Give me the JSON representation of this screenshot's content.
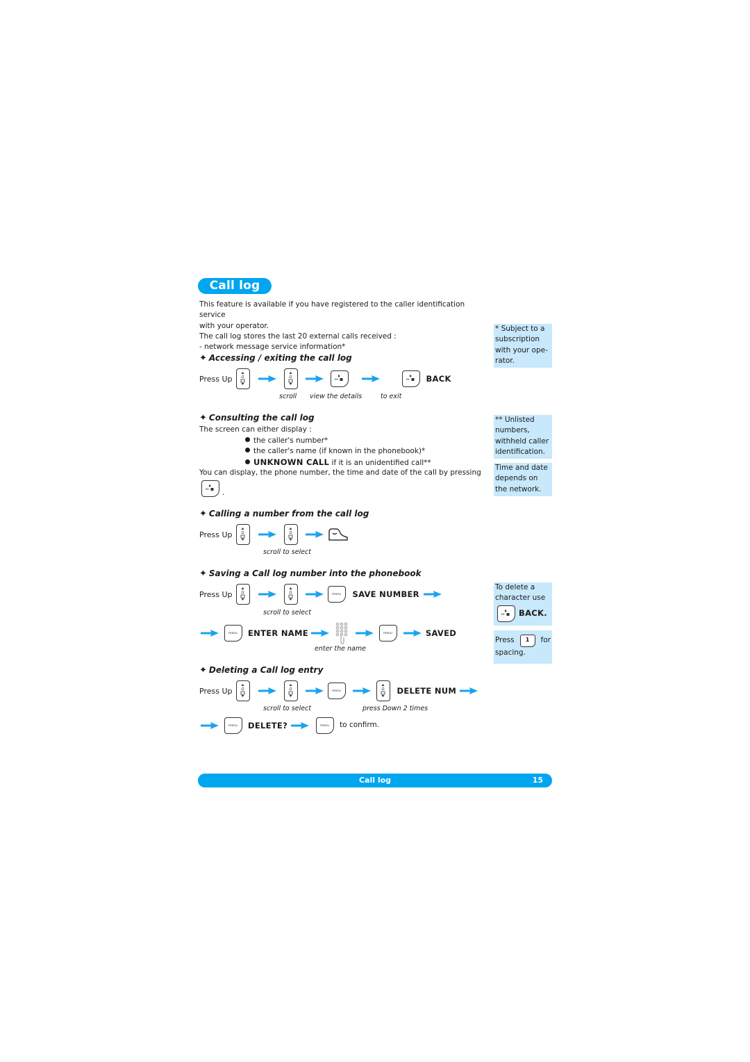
{
  "page": {
    "title": "Call log",
    "intro_lines": [
      "This feature is available if you have registered to the caller identification service",
      "with your operator.",
      "The call log stores the last 20 external calls received :",
      "- network message service information*"
    ]
  },
  "side_notes": {
    "subscription": [
      "* Subject to a",
      "subscription",
      "with your ope-",
      "rator."
    ],
    "unlisted": [
      "** Unlisted",
      "numbers,",
      "withheld caller",
      "identification."
    ],
    "time_date": [
      "Time and date",
      "depends on",
      "the network."
    ],
    "delete_char": {
      "line1": "To delete a",
      "line2": "character use",
      "back_label": "BACK."
    },
    "spacing": {
      "press": "Press",
      "for": "for",
      "spacing": "spacing.",
      "key_glyph": "1"
    }
  },
  "icons": {
    "nav_key_glyph": "▲\n☏\n▼",
    "softkey_glyph": "↔▶",
    "menu_glyph": "menu"
  },
  "sections": {
    "accessing": {
      "heading": "Accessing / exiting the call log",
      "press_up": "Press Up",
      "back": "BACK",
      "captions": {
        "scroll": "scroll",
        "view": "view the details",
        "exit": "to exit"
      }
    },
    "consulting": {
      "heading": "Consulting the call log",
      "intro": "The screen can either display :",
      "bullets": [
        {
          "bold": "",
          "text": "the caller's number*"
        },
        {
          "bold": "",
          "text": "the caller's name (if known in the phonebook)*"
        },
        {
          "bold": "UNKNOWN CALL",
          "text": " if it is an unidentified call**"
        }
      ],
      "outro": "You can display, the phone number, the time and date of the call by pressing",
      "outro_end": "."
    },
    "calling": {
      "heading": "Calling a number from the call log",
      "press_up": "Press Up",
      "caption": "scroll to select"
    },
    "saving": {
      "heading": "Saving a Call log number into the phonebook",
      "press_up": "Press Up",
      "save_number": "SAVE NUMBER",
      "caption_scroll": "scroll to select",
      "enter_name": "ENTER NAME",
      "saved": "SAVED",
      "caption_enter": "enter the name"
    },
    "deleting": {
      "heading": "Deleting a Call log entry",
      "press_up": "Press Up",
      "delete_num": "DELETE NUM",
      "caption_scroll": "scroll to select",
      "caption_down": "press Down 2 times",
      "delete_q": "DELETE?",
      "confirm": "to confirm."
    }
  },
  "footer": {
    "title": "Call log",
    "page_number": "15"
  },
  "colors": {
    "accent": "#00a6ef",
    "note_bg": "#c8e8fb",
    "arrow": "#1aa3ee"
  }
}
